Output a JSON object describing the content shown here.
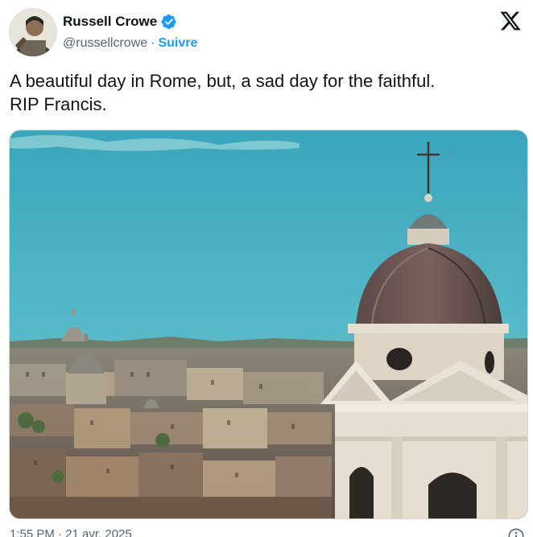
{
  "author": {
    "name": "Russell Crowe",
    "handle": "@russellcrowe",
    "separator": "·",
    "follow_label": "Suivre",
    "verified_icon": "verified-badge-icon",
    "avatar_icon": "avatar"
  },
  "platform_logo": "x-logo-icon",
  "tweet": {
    "text": "A beautiful day in Rome, but, a sad day for the faithful.\nRIP Francis."
  },
  "footer": {
    "timestamp": "1:55 PM · 21 avr. 2025",
    "info_icon": "info-icon"
  },
  "colors": {
    "accent": "#1d9bf0",
    "text": "#0f1419",
    "secondary_text": "#536471",
    "sky": "#4fb3c4"
  }
}
